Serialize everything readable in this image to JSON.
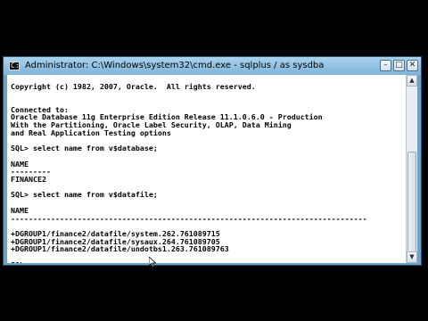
{
  "window": {
    "title": "Administrator: C:\\Windows\\system32\\cmd.exe - sqlplus  / as sysdba",
    "icon": "cmd-icon",
    "controls": [
      "minimize-icon",
      "maximize-icon",
      "close-icon"
    ]
  },
  "console": {
    "lines": [
      "",
      "Copyright (c) 1982, 2007, Oracle.  All rights reserved.",
      "",
      "",
      "Connected to:",
      "Oracle Database 11g Enterprise Edition Release 11.1.0.6.0 - Production",
      "With the Partitioning, Oracle Label Security, OLAP, Data Mining",
      "and Real Application Testing options",
      "",
      "SQL> select name from v$database;",
      "",
      "NAME",
      "---------",
      "FINANCE2",
      "",
      "SQL> select name from v$datafile;",
      "",
      "NAME",
      "--------------------------------------------------------------------------------",
      "",
      "+DGROUP1/finance2/datafile/system.262.761089715",
      "+DGROUP1/finance2/datafile/sysaux.264.761089705",
      "+DGROUP1/finance2/datafile/undotbs1.263.761089763",
      "",
      "SQL> "
    ]
  }
}
